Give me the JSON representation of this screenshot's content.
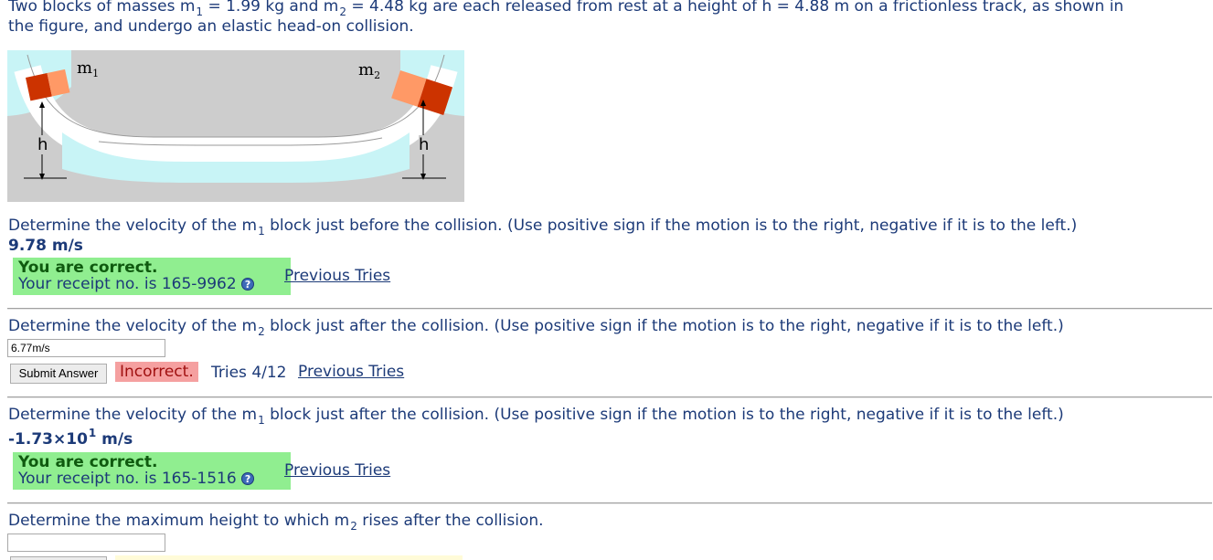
{
  "problem": {
    "intro_a": "Two blocks of masses m",
    "intro_b": " = 1.99 kg and m",
    "intro_c": " = 4.48 kg are each released from rest at a height of h = 4.88 m on a frictionless track, as shown in",
    "intro_line2": "the figure, and undergo an elastic head-on collision.",
    "sub1": "1",
    "sub2": "2"
  },
  "figure": {
    "label_m1": "m",
    "label_m1_sub": "1",
    "label_m2": "m",
    "label_m2_sub": "2",
    "label_h": "h"
  },
  "parts": [
    {
      "q_a": "Determine the velocity of the m",
      "q_sub": "1",
      "q_b": " block just before the collision. (Use positive sign if the motion is to the right, negative if it is to the left.)",
      "answer": "9.78 m/s",
      "status_title": "You are correct.",
      "status_receipt": "Your receipt no. is 165-9962",
      "previous_tries": "Previous Tries"
    },
    {
      "q_a": "Determine the velocity of the m",
      "q_sub": "2",
      "q_b": " block just after the collision. (Use positive sign if the motion is to the right, negative if it is to the left.)",
      "input_value": "6.77m/s",
      "submit_label": "Submit Answer",
      "status": "Incorrect.",
      "tries": "Tries 4/12",
      "previous_tries": "Previous Tries"
    },
    {
      "q_a": "Determine the velocity of the m",
      "q_sub": "1",
      "q_b": " block just after the collision. (Use positive sign if the motion is to the right, negative if it is to the left.)",
      "answer_a": "-1.73×10",
      "answer_exp": "1",
      "answer_b": " m/s",
      "status_title": "You are correct.",
      "status_receipt": "Your receipt no. is 165-1516",
      "previous_tries": "Previous Tries"
    },
    {
      "q_a": "Determine the maximum height to which m",
      "q_sub": "2",
      "q_b": " rises after the collision.",
      "input_value": ""
    }
  ],
  "icons": {
    "help": "?"
  },
  "colors": {
    "text": "#1c3a78",
    "correct_bg": "#90ee90",
    "incorrect_bg": "#f5a0a0",
    "track_water": "#c8f4f6",
    "block_red": "#cc3300",
    "block_orange": "#ff9966"
  }
}
